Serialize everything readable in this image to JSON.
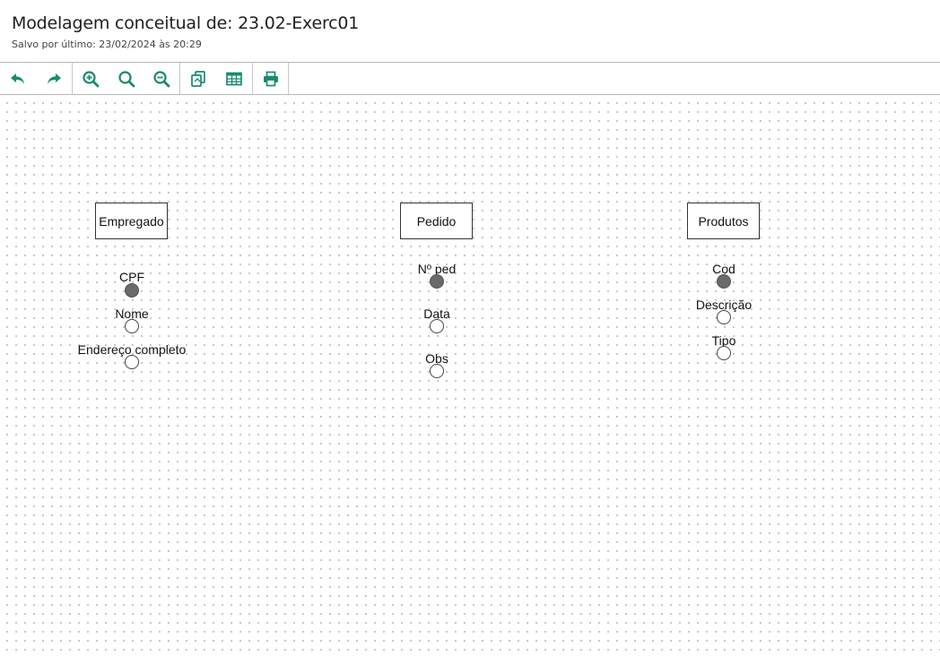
{
  "header": {
    "title": "Modelagem conceitual de: 23.02-Exerc01",
    "subtitle": "Salvo por último: 23/02/2024 às 20:29"
  },
  "toolbar": {
    "accent_color": "#1a8a6e",
    "buttons": [
      {
        "icon": "undo-icon"
      },
      {
        "icon": "redo-icon"
      },
      {
        "icon": "zoom-in-icon"
      },
      {
        "icon": "zoom-reset-icon"
      },
      {
        "icon": "zoom-out-icon"
      },
      {
        "icon": "copy-icon"
      },
      {
        "icon": "table-icon"
      },
      {
        "icon": "print-icon"
      }
    ]
  },
  "diagram": {
    "entities": [
      {
        "name": "Empregado",
        "attributes": [
          {
            "label": "CPF",
            "key": true
          },
          {
            "label": "Nome",
            "key": false
          },
          {
            "label": "Endereço completo",
            "key": false
          }
        ]
      },
      {
        "name": "Pedido",
        "attributes": [
          {
            "label": "Nº ped",
            "key": true
          },
          {
            "label": "Data",
            "key": false
          },
          {
            "label": "Obs",
            "key": false
          }
        ]
      },
      {
        "name": "Produtos",
        "attributes": [
          {
            "label": "Cod",
            "key": true
          },
          {
            "label": "Descrição",
            "key": false
          },
          {
            "label": "Tipo",
            "key": false
          }
        ]
      }
    ]
  }
}
